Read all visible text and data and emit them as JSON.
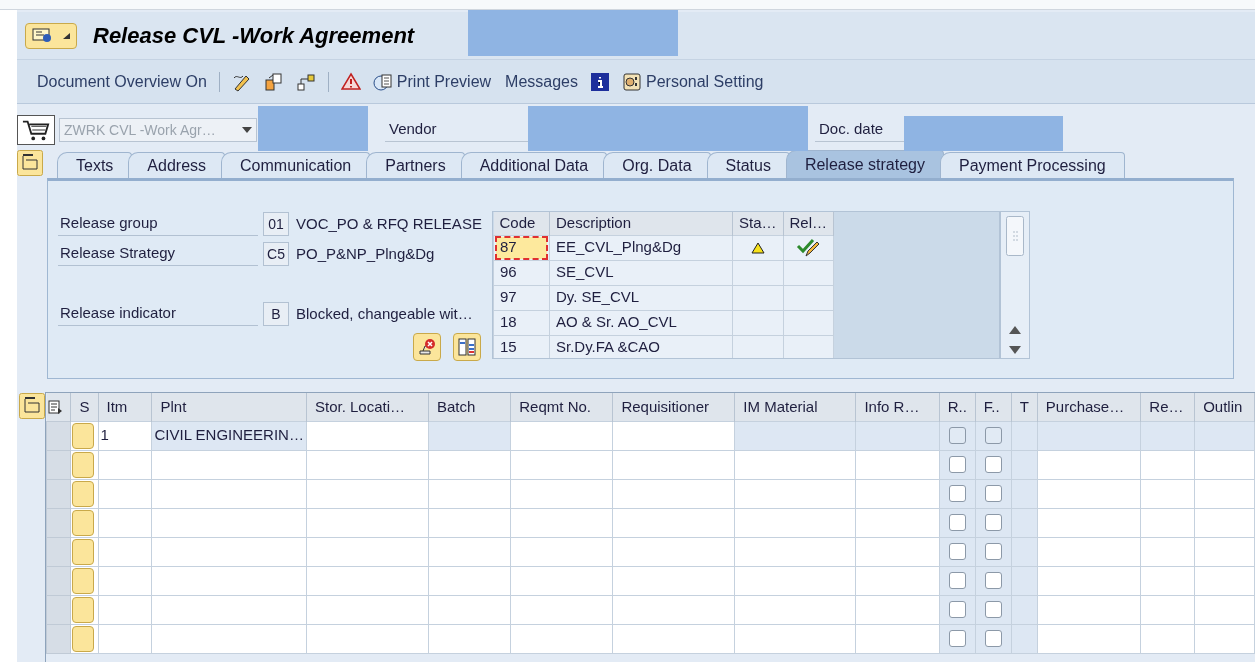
{
  "window": {
    "title": "Release CVL -Work Agreement"
  },
  "toolbar": [
    {
      "kind": "text",
      "label": "Document Overview On"
    },
    {
      "kind": "separator"
    },
    {
      "kind": "icon"
    },
    {
      "kind": "icon"
    },
    {
      "kind": "icon"
    },
    {
      "kind": "separator"
    },
    {
      "kind": "icon"
    },
    {
      "kind": "icon_text",
      "label": "Print Preview"
    },
    {
      "kind": "text",
      "label": "Messages"
    },
    {
      "kind": "icon"
    },
    {
      "kind": "icon_text",
      "label": "Personal Setting"
    }
  ],
  "header": {
    "document_type": "ZWRK CVL -Work Agr…",
    "vendor_label": "Vendor",
    "doc_date_label": "Doc. date"
  },
  "tabs": [
    {
      "label": "Texts",
      "selected": false
    },
    {
      "label": "Address",
      "selected": false
    },
    {
      "label": "Communication",
      "selected": false
    },
    {
      "label": "Partners",
      "selected": false
    },
    {
      "label": "Additional Data",
      "selected": false
    },
    {
      "label": "Org. Data",
      "selected": false
    },
    {
      "label": "Status",
      "selected": false
    },
    {
      "label": "Release strategy",
      "selected": true
    },
    {
      "label": "Payment Processing",
      "selected": false
    }
  ],
  "release": {
    "fields": [
      {
        "label": "Release group",
        "code": "01",
        "text": "VOC_PO & RFQ RELEASE"
      },
      {
        "label": "Release Strategy",
        "code": "C5",
        "text": "PO_P&NP_Plng&Dg"
      },
      {
        "label": "Release indicator",
        "code": "B",
        "text": "Blocked, changeable wit…"
      }
    ],
    "table": {
      "columns": [
        "Code",
        "Description",
        "Sta…",
        "Rel…"
      ],
      "rows": [
        {
          "code": "87",
          "description": "EE_CVL_Plng&Dg",
          "selected": true,
          "warning": true,
          "release_allowed": true
        },
        {
          "code": "96",
          "description": "SE_CVL",
          "selected": false,
          "warning": false,
          "release_allowed": false
        },
        {
          "code": "97",
          "description": "Dy. SE_CVL",
          "selected": false,
          "warning": false,
          "release_allowed": false
        },
        {
          "code": "18",
          "description": "AO & Sr. AO_CVL",
          "selected": false,
          "warning": false,
          "release_allowed": false
        },
        {
          "code": "15",
          "description": "Sr.Dy.FA &CAO",
          "selected": false,
          "warning": false,
          "release_allowed": false
        }
      ]
    }
  },
  "items": {
    "columns": [
      "S",
      "Itm",
      "Plnt",
      "Stor. Locati…",
      "Batch",
      "Reqmt No.",
      "Requisitioner",
      "IM Material",
      "Info R…",
      "R..",
      "F..",
      "T",
      "Purchase…",
      "Re…",
      "Outlin"
    ],
    "rows": [
      {
        "itm": "1",
        "plnt": "CIVIL ENGINEERIN…",
        "editable": false,
        "r_checked": false,
        "f_checked": false
      },
      {
        "editable": true,
        "r_checked": false,
        "f_checked": false
      },
      {
        "editable": true,
        "r_checked": false,
        "f_checked": false
      },
      {
        "editable": true,
        "r_checked": false,
        "f_checked": false
      },
      {
        "editable": true,
        "r_checked": false,
        "f_checked": false
      },
      {
        "editable": true,
        "r_checked": false,
        "f_checked": false
      },
      {
        "editable": true,
        "r_checked": false,
        "f_checked": false
      },
      {
        "editable": true,
        "r_checked": false,
        "f_checked": false
      }
    ]
  }
}
